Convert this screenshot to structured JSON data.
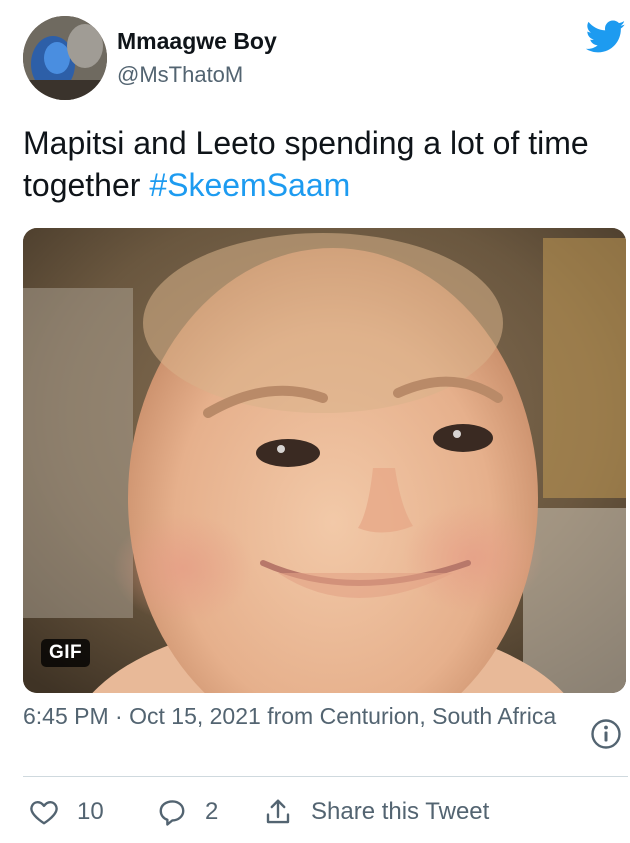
{
  "user": {
    "display_name": "Mmaagwe Boy",
    "handle": "@MsThatoM",
    "avatar_icon": "avatar-photo"
  },
  "brand_icon": "twitter-bird-icon",
  "colors": {
    "accent": "#1d9bf0",
    "text": "#0f1419",
    "secondary": "#536471",
    "divider": "#cfd9de"
  },
  "tweet": {
    "text": "Mapitsi and Leeto spending a lot of time together ",
    "hashtag": "#SkeemSaam"
  },
  "media": {
    "type": "gif",
    "badge": "GIF",
    "description_icon": "baby-smiling-gif"
  },
  "meta": {
    "time": "6:45 PM",
    "separator": " · ",
    "date": "Oct 15, 2021",
    "source": " from Centurion, South Africa"
  },
  "actions": {
    "likes": "10",
    "replies": "2",
    "share_label": "Share this Tweet"
  }
}
